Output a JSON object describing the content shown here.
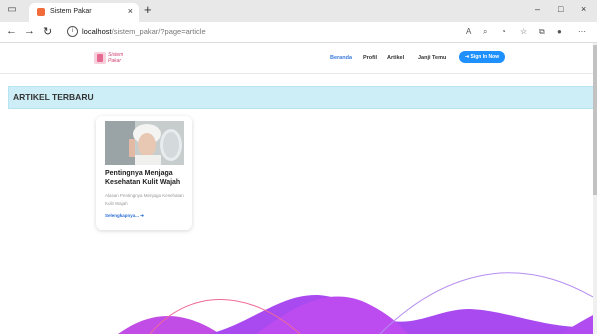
{
  "browser": {
    "tab_title": "Sistem Pakar",
    "tab_close": "×",
    "new_tab": "+",
    "url_host": "localhost",
    "url_path": "/sistem_pakar/?page=article",
    "controls": {
      "minimize": "–",
      "maximize": "□",
      "close": "×"
    }
  },
  "site": {
    "logo_line1": "Sistem",
    "logo_line2": "Pakar",
    "nav": [
      "Beranda",
      "Profil",
      "Artikel",
      "Janji Temu"
    ],
    "signin_label": "⇥ Sign In Now"
  },
  "section": {
    "title": "ARTIKEL TERBARU"
  },
  "article": {
    "title": "Pentingnya Menjaga Kesehatan Kulit Wajah",
    "description": "Alasan Pentingnya Menjaga Kesehatan Kulit Wajah",
    "read_more": "Selengkapnya... ➔"
  },
  "colors": {
    "accent": "#1e90ff",
    "section_bg": "#cdeef7",
    "wave_purple": "#b14cf0",
    "wave_pink": "#ef6a9a"
  }
}
